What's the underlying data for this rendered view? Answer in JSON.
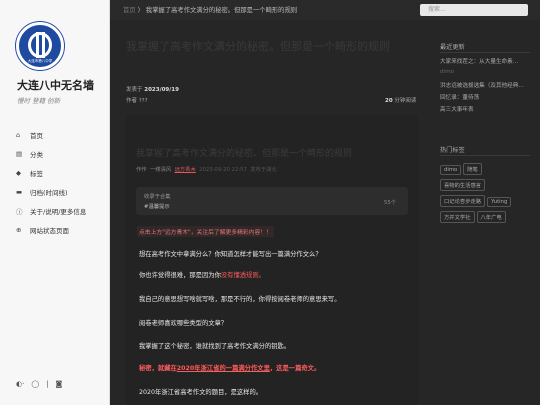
{
  "sidebar": {
    "logo_text": "大连市第八中学",
    "site_title": "大连八中无名墙",
    "site_subtitle": "慢时 登籍 创新",
    "nav": [
      {
        "icon": "home-icon",
        "glyph": "⌂",
        "label": "首页"
      },
      {
        "icon": "category-icon",
        "glyph": "▤",
        "label": "分类"
      },
      {
        "icon": "tag-icon",
        "glyph": "◆",
        "label": "标签"
      },
      {
        "icon": "archive-icon",
        "glyph": "▬",
        "label": "归档(时间线)"
      },
      {
        "icon": "info-icon",
        "glyph": "ⓘ",
        "label": "关于/说明/更多信息"
      },
      {
        "icon": "globe-icon",
        "glyph": "⊕",
        "label": "网站状态页面"
      }
    ],
    "footer_icons": [
      "theme-toggle-icon",
      "github-icon",
      "separator",
      "rss-icon"
    ]
  },
  "topbar": {
    "breadcrumb_home": "首页",
    "breadcrumb_sep": "〉",
    "breadcrumb_current": "我掌握了高考作文满分的秘密。但那是一个畸形的规则",
    "search_placeholder": "搜索..."
  },
  "article": {
    "overlay_title": "我掌握了高考作文满分的秘密。但那是一个畸形的规则",
    "published_label": "发表于",
    "published_date": "2023/09/19",
    "author_label": "作者 ???",
    "read_time": "20",
    "read_time_label": "分钟阅读",
    "card_title": "我掌握了高考作文满分的秘密。但那是一个畸形的规则",
    "byline_prefix": "作作",
    "byline_author1": "一缕清风",
    "byline_author2": "远方青木",
    "byline_time": "2023-09-20 22:57",
    "byline_from": "发布于湖北",
    "collection_title": "收录于合集",
    "collection_name": "#温馨提示",
    "collection_count": "55个",
    "notice": "点击上方\"远方青木\"，关注后了解更多精彩内容！！",
    "paragraphs": [
      {
        "pre": "想在高考作文中拿满分么？你知道怎样才能写出一篇满分作文么？",
        "red": "",
        "post": ""
      },
      {
        "pre": "你也许觉得很难，那是因为你",
        "red": "没有懂透规则。",
        "post": ""
      },
      {
        "pre": "我自己的意思想写啥就写啥，那是不行的，你得按阅卷老师的意思来写。",
        "red": "",
        "post": ""
      },
      {
        "pre": "阅卷老师喜欢哪些类型的文章？",
        "red": "",
        "post": ""
      },
      {
        "pre": "我掌握了这个秘密，谁就找到了高考作文满分的钥匙。",
        "red": "",
        "post": ""
      },
      {
        "pre": "秘密，就藏在",
        "red": "2020年浙江省的一篇满分作文里",
        "post": "，这是一篇奇文。"
      },
      {
        "pre": "2020年浙江省高考作文的题目，是这样的。",
        "red": "",
        "post": ""
      }
    ]
  },
  "right_panel": {
    "recent_title": "最近更新",
    "recent": [
      "大家来找茬之：从大量生命素…",
      "dimo",
      "洪志远被选拔选集（及其他经典…",
      "回忆录：董侍荡",
      "高三大事年表"
    ],
    "tags_title": "热门标签",
    "tags": [
      "dimo",
      "随笔",
      "喜物的生活感言",
      "口记论杏步走路",
      "Yuting",
      "方并文学社",
      "八年广电"
    ]
  }
}
